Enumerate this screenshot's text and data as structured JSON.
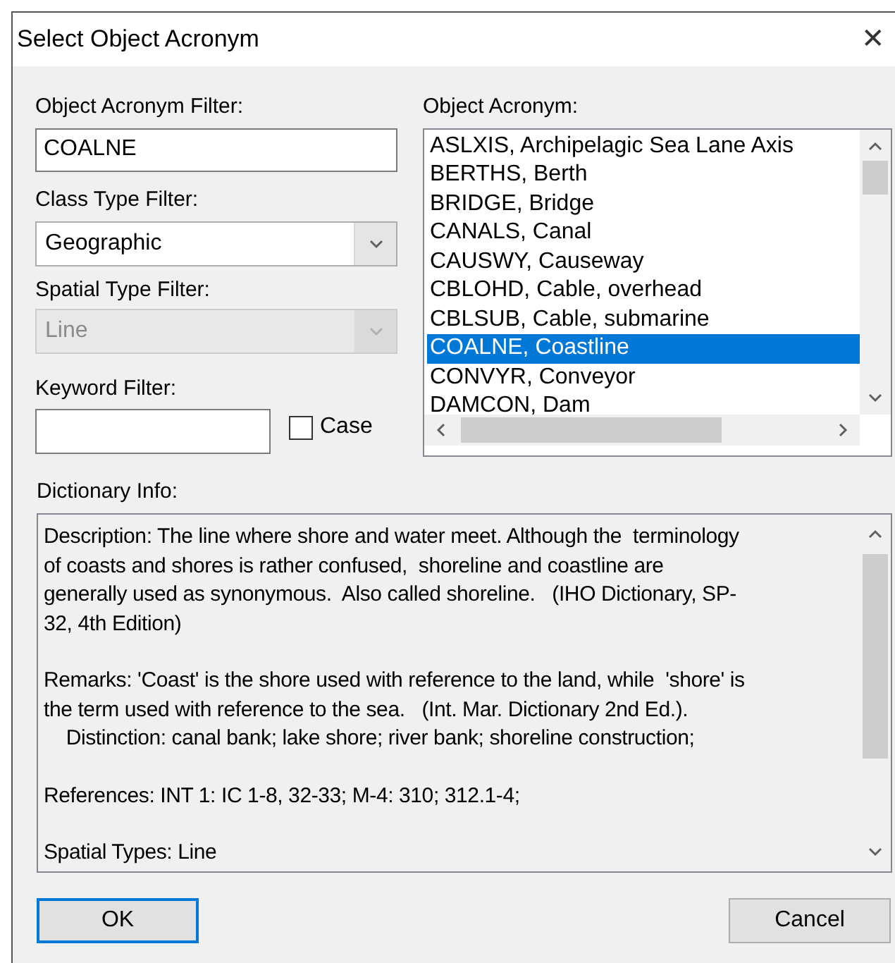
{
  "window": {
    "title": "Select Object Acronym",
    "close": "✕"
  },
  "acronym_filter": {
    "label": "Object Acronym Filter:",
    "value": "COALNE"
  },
  "class_type_filter": {
    "label": "Class Type Filter:",
    "value": "Geographic",
    "disabled": false
  },
  "spatial_type_filter": {
    "label": "Spatial Type Filter:",
    "value": "Line",
    "disabled": true
  },
  "keyword_filter": {
    "label": "Keyword Filter:",
    "case": {
      "label": "Case",
      "checked": false
    }
  },
  "object_acronym": {
    "label": "Object Acronym:",
    "items": [
      {
        "text": "ASLXIS, Archipelagic Sea Lane Axis",
        "selected": false
      },
      {
        "text": "BERTHS, Berth",
        "selected": false
      },
      {
        "text": "BRIDGE, Bridge",
        "selected": false
      },
      {
        "text": "CANALS, Canal",
        "selected": false
      },
      {
        "text": "CAUSWY, Causeway",
        "selected": false
      },
      {
        "text": "CBLOHD, Cable, overhead",
        "selected": false
      },
      {
        "text": "CBLSUB, Cable, submarine",
        "selected": false
      },
      {
        "text": "COALNE, Coastline",
        "selected": true
      },
      {
        "text": "CONVYR, Conveyor",
        "selected": false
      },
      {
        "text": "DAMCON, Dam",
        "selected": false
      }
    ]
  },
  "dictionary_info": {
    "label": "Dictionary Info:",
    "paragraphs": [
      "Description: The line where shore and water meet. Although the  terminology\nof coasts and shores is rather confused,  shoreline and coastline are\ngenerally used as synonymous.  Also called shoreline.   (IHO Dictionary, SP-\n32, 4th Edition)",
      "Remarks: 'Coast' is the shore used with reference to the land, while  'shore' is\nthe term used with reference to the sea.   (Int. Mar. Dictionary 2nd Ed.).\n    Distinction: canal bank; lake shore; river bank; shoreline construction;",
      "References: INT 1: IC 1-8, 32-33; M-4: 310; 312.1-4;",
      "Spatial Types: Line"
    ]
  },
  "buttons": [
    {
      "label": "OK",
      "default": true
    },
    {
      "label": "Cancel",
      "default": false
    }
  ]
}
